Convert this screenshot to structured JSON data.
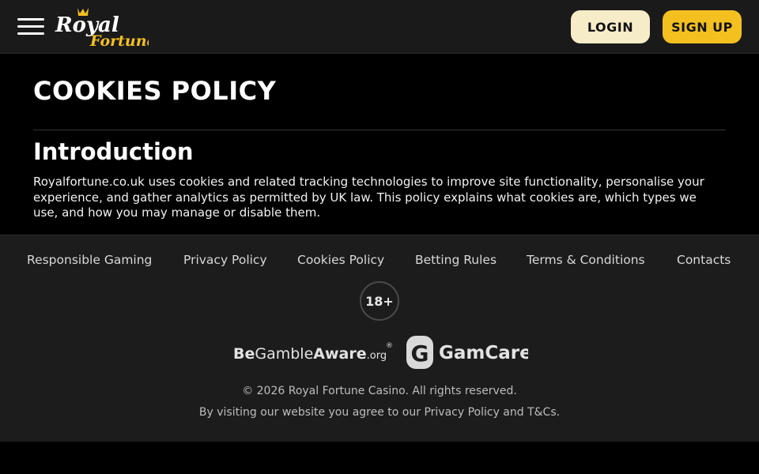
{
  "header": {
    "logo": {
      "top_text": "Royal",
      "bottom_text": "Fortune",
      "accent": "#f4c020"
    },
    "menu_icon": "hamburger-icon",
    "login_label": "LOGIN",
    "signup_label": "SIGN UP"
  },
  "main": {
    "title": "COOKIES POLICY",
    "section_title": "Introduction",
    "section_body": "Royalfortune.co.uk uses cookies and related tracking technologies to improve site functionality, personalise your experience, and gather analytics as permitted by UK law. This policy explains what cookies are, which types we use, and how you may manage or disable them."
  },
  "footer": {
    "links": [
      {
        "label": "Responsible Gaming"
      },
      {
        "label": "Privacy Policy"
      },
      {
        "label": "Cookies Policy"
      },
      {
        "label": "Betting Rules"
      },
      {
        "label": "Terms & Conditions"
      },
      {
        "label": "Contacts"
      }
    ],
    "age_badge": "18+",
    "begambleaware": {
      "be": "Be",
      "gamble": "Gamble",
      "aware": "Aware",
      "org": ".org",
      "reg": "®"
    },
    "gamcare": {
      "letter": "G",
      "name": "GamCare"
    },
    "copyright": "© 2026 Royal Fortune Casino. All rights reserved.",
    "agree_text": "By visiting our website you agree to our Privacy Policy and T&Cs."
  },
  "colors": {
    "background": "#000000",
    "header_bg": "#1a1a1a",
    "footer_bg": "#1c1c1c",
    "login_bg": "#f7ecc8",
    "signup_bg": "#f4c020",
    "brand_gold": "#f4c020"
  }
}
